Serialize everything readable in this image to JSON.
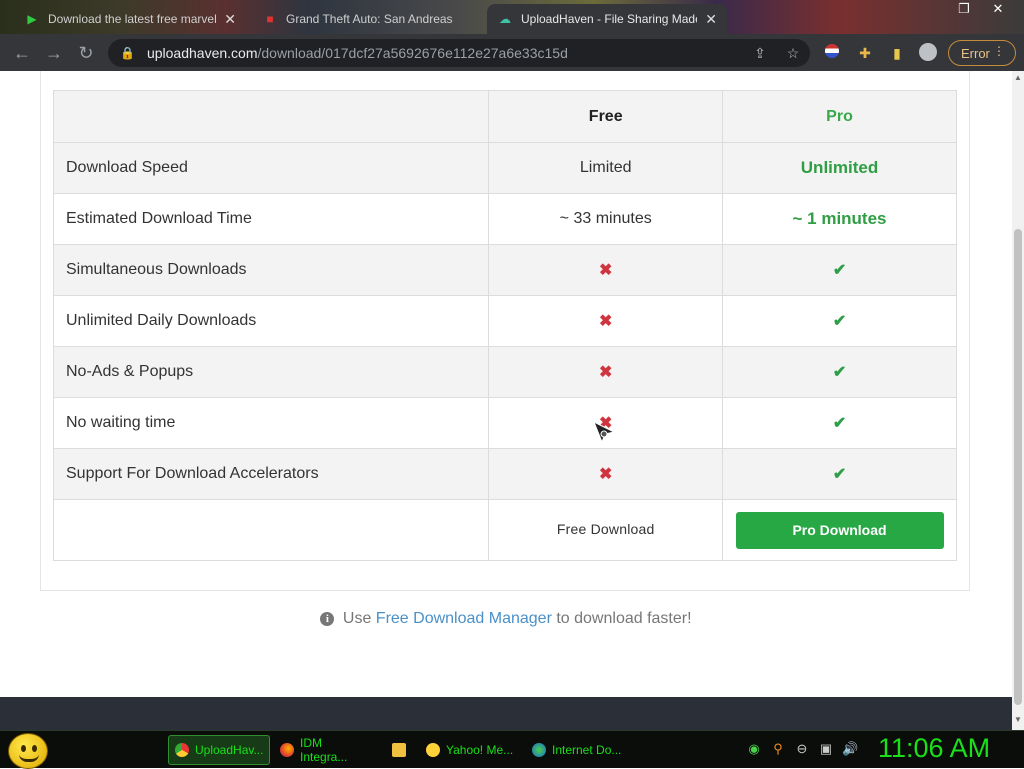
{
  "browser": {
    "tabs": [
      {
        "title": "Download the latest free marvel",
        "active": false
      },
      {
        "title": "Grand Theft Auto: San Andreas",
        "active": false
      },
      {
        "title": "UploadHaven - File Sharing Made",
        "active": true
      }
    ],
    "url_host": "uploadhaven.com",
    "url_path": "/download/017dcf27a5692676e112e27a6e33c15d",
    "error_label": "Error"
  },
  "table": {
    "header": {
      "free": "Free",
      "pro": "Pro"
    },
    "rows": [
      {
        "feature": "Download Speed",
        "free": "Limited",
        "pro": "Unlimited"
      },
      {
        "feature": "Estimated Download Time",
        "free": "~ 33 minutes",
        "pro": "~ 1 minutes"
      },
      {
        "feature": "Simultaneous Downloads",
        "free": "✖",
        "pro": "✔"
      },
      {
        "feature": "Unlimited Daily Downloads",
        "free": "✖",
        "pro": "✔"
      },
      {
        "feature": "No-Ads & Popups",
        "free": "✖",
        "pro": "✔"
      },
      {
        "feature": "No waiting time",
        "free": "✖",
        "pro": "✔"
      },
      {
        "feature": "Support For Download Accelerators",
        "free": "✖",
        "pro": "✔"
      }
    ],
    "free_download_label": "Free Download",
    "pro_download_label": "Pro Download"
  },
  "hint": {
    "prefix": "Use",
    "link": "Free Download Manager",
    "suffix": "to download faster!"
  },
  "taskbar": {
    "tasks": [
      "UploadHav...",
      "IDM Integra...",
      "Yahoo! Me...",
      "Internet Do..."
    ],
    "clock": "11:06 AM"
  },
  "colors": {
    "pro_green": "#28a745",
    "cross_red": "#d0343f",
    "link_blue": "#4a90c8"
  }
}
